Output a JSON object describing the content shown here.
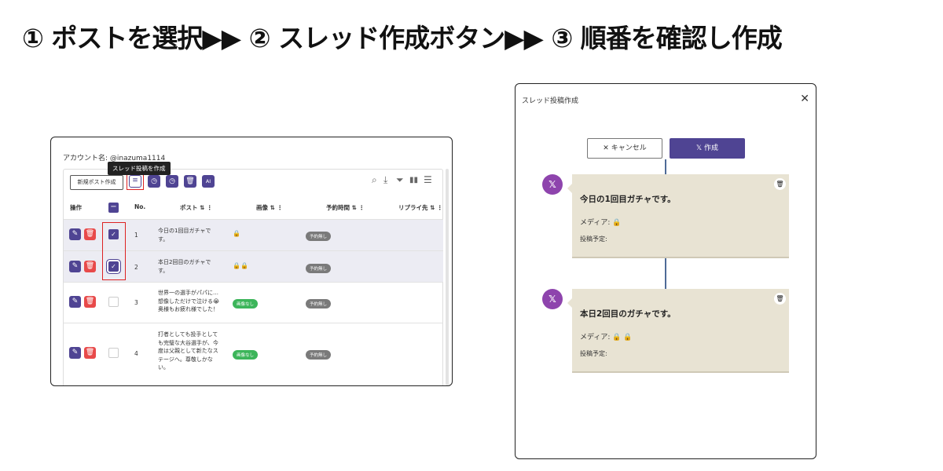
{
  "headline": "① ポストを選択▶▶ ② スレッド作成ボタン▶▶ ③ 順番を確認し作成",
  "left": {
    "account_label": "アカウント名: @inazuma1114",
    "tooltip": "スレッド投稿を作成",
    "new_post_button": "新規ポスト作成",
    "ai_button": "AI",
    "headers": {
      "action": "操作",
      "no": "No.",
      "post": "ポスト ⇅ ⋮",
      "image": "画像 ⇅ ⋮",
      "schedule": "予約時間 ⇅ ⋮",
      "reply": "リプライ先 ⇅ ⋮"
    },
    "rows": [
      {
        "no": "1",
        "post": "今日の1回目ガチャです。",
        "media": "🔒",
        "status": "予約無し"
      },
      {
        "no": "2",
        "post": "本日2回目のガチャです。",
        "media": "🔒🔒",
        "status": "予約無し"
      },
      {
        "no": "3",
        "post": "世界一の選手がパパに…想像しただけで泣ける😭 奥様もお疲れ様でした！",
        "image_status": "画像なし",
        "status": "予約無し"
      },
      {
        "no": "4",
        "post": "打者としても投手としても完璧な大谷選手が、今度は父親として新たなステージへ。尊敬しかない。",
        "image_status": "画像なし",
        "status": "予約無し"
      }
    ]
  },
  "modal": {
    "title": "スレッド投稿作成",
    "cancel": "キャンセル",
    "create": "作成",
    "cards": [
      {
        "title": "今日の1回目ガチャです。",
        "media": "メディア: 🔒",
        "schedule": "投稿予定:"
      },
      {
        "title": "本日2回目のガチャです。",
        "media": "メディア: 🔒 🔒",
        "schedule": "投稿予定:"
      }
    ]
  },
  "colors": {
    "accent": "#4f4493",
    "danger": "#e84a4a",
    "green": "#3cb55a",
    "card": "#e8e3d3",
    "x_circle": "#8e44ad"
  }
}
